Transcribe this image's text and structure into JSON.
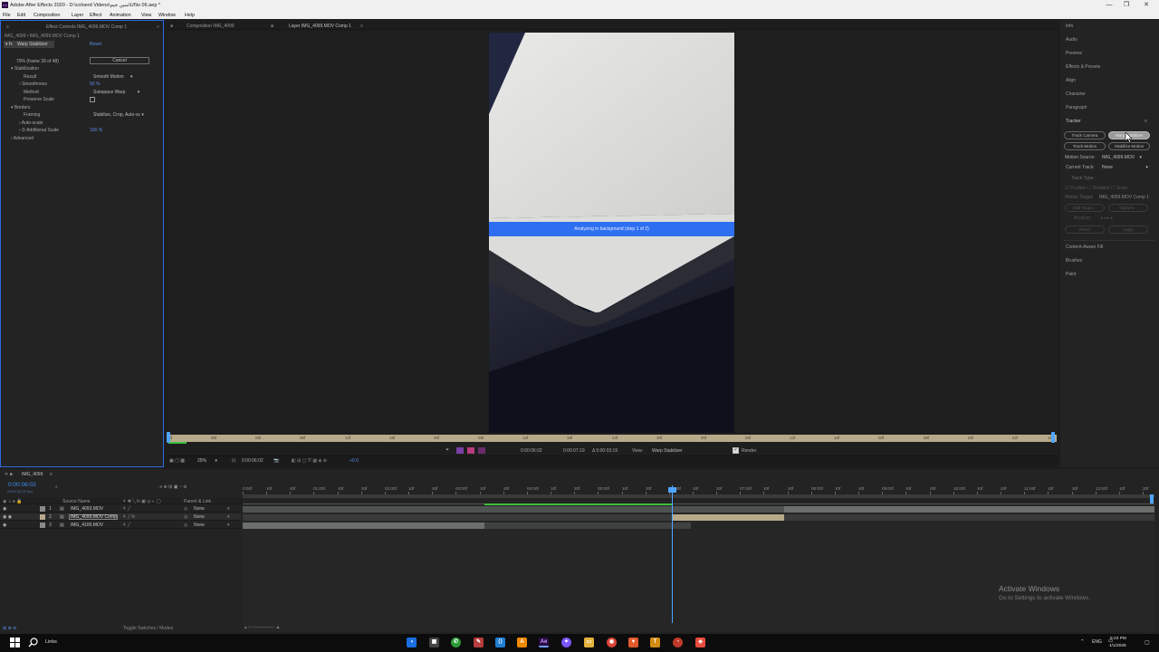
{
  "app": {
    "title": "Adobe After Effects 2020 - D:\\coloerd Videos\\سين جيم\\UI\\tv 06.aep *",
    "logo_text": "Ae",
    "window_controls": [
      "—",
      "❐",
      "✕"
    ]
  },
  "menu": [
    "File",
    "Edit",
    "Composition",
    "Layer",
    "Effect",
    "Animation",
    "View",
    "Window",
    "Help"
  ],
  "effect_controls": {
    "tab_label": "Effect Controls IMG_4099.MOV Comp 1",
    "subheader": "IMG_4099 • IMG_4099.MOV Comp 1",
    "effect_name": "Warp Stabilizer",
    "reset_label": "Reset",
    "progress_text": "79% (frame 39 of 48)",
    "cancel_label": "Cancel",
    "properties": [
      {
        "label": "Stabilization",
        "value": ""
      },
      {
        "label": "Result",
        "value": "Smooth Motion"
      },
      {
        "label": "Smoothness",
        "value": "50 %"
      },
      {
        "label": "Method",
        "value": "Subspace Warp"
      },
      {
        "label": "Preserve Scale",
        "value": ""
      },
      {
        "label": "Borders",
        "value": ""
      },
      {
        "label": "Framing",
        "value": "Stabilize, Crop, Auto-sc"
      },
      {
        "label": "Auto-scale",
        "value": ""
      },
      {
        "label": "Additional Scale",
        "value": "100 %"
      },
      {
        "label": "Advanced",
        "value": ""
      }
    ]
  },
  "viewer": {
    "tab_composition": "Composition IMG_4099",
    "tab_layer": "Layer IMG_4099.MOV Comp 1",
    "analyzing_text": "Analyzing in background (step 1 of 2)",
    "ruler_labels": [
      "00f",
      "06f",
      "06f",
      "06f",
      "12f",
      "18f",
      "00f",
      "06f",
      "12f",
      "18f",
      "24f",
      "30f",
      "00f",
      "06f",
      "12f",
      "18f",
      "00f",
      "06f",
      "06f",
      "02f",
      "18f"
    ],
    "in_time": "0:00:06:02",
    "out_time": "0:00:07:19",
    "duration": "Δ 0:00:03:19",
    "view_label": "View:",
    "view_value": "Warp Stabilizer",
    "render_label": "Render",
    "zoom": "25%",
    "current_time": "0:00:06:02",
    "exposure": "+0.0"
  },
  "right_panels": {
    "items": [
      "Info",
      "Audio",
      "Preview",
      "Effects & Presets",
      "Align",
      "Character",
      "Paragraph",
      "Tracker"
    ],
    "tracker": {
      "track_camera": "Track Camera",
      "warp_stabilizer": "Warp Stabilizer",
      "track_motion": "Track Motion",
      "stabilize_motion": "Stabilize Motion",
      "motion_source_label": "Motion Source:",
      "motion_source_value": "IMG_4099.MOV",
      "current_track_label": "Current Track:",
      "current_track_value": "None",
      "track_type_label": "Track Type:",
      "position": "Position",
      "rotation": "Rotation",
      "scale": "Scale",
      "motion_target_label": "Motion Target:",
      "motion_target_value": "IMG_4099.MOV Comp 1",
      "edit_target": "Edit Target...",
      "options": "Options...",
      "analyze": "Analyze:",
      "reset": "Reset",
      "apply": "Apply"
    },
    "lower_items": [
      "Content-Aware Fill",
      "Brushes",
      "Paint"
    ]
  },
  "timeline": {
    "tab_label": "IMG_4099",
    "timecode": "0:00:06:02",
    "fps": "00182 (30.00 fps)",
    "col_source": "Source Name",
    "col_parent": "Parent & Link",
    "layers": [
      {
        "num": "1",
        "name": "IMG_4093.MOV",
        "parent": "None"
      },
      {
        "num": "2",
        "name": "IMG_4099.MOV Comp 1",
        "parent": "None"
      },
      {
        "num": "3",
        "name": "IMG_4100.MOV",
        "parent": "None"
      }
    ],
    "ruler": [
      "0:00f",
      "10f",
      "20f",
      "01:00f",
      "10f",
      "20f",
      "02:00f",
      "10f",
      "20f",
      "03:00f",
      "10f",
      "20f",
      "04:00f",
      "10f",
      "20f",
      "05:00f",
      "10f",
      "20f",
      "06:00f",
      "10f",
      "20f",
      "07:00f",
      "10f",
      "20f",
      "08:00f",
      "10f",
      "20f",
      "09:00f",
      "10f",
      "20f",
      "10:00f",
      "10f",
      "20f",
      "11:00f",
      "10f",
      "20f",
      "12:00f",
      "10f",
      "20f"
    ],
    "toggle_label": "Toggle Switches / Modes",
    "links_label": "Links"
  },
  "activate_windows": {
    "title": "Activate Windows",
    "subtitle": "Go to Settings to activate Windows."
  },
  "taskbar": {
    "links_label": "Links",
    "lang": "ENG",
    "time": "6:23 PM",
    "date": "1/1/2026"
  },
  "colors": {
    "accent_blue": "#2f6ff0",
    "ui_dark": "#232323",
    "ruler_tan": "#b8ab8b",
    "playhead": "#4fa6ff"
  }
}
